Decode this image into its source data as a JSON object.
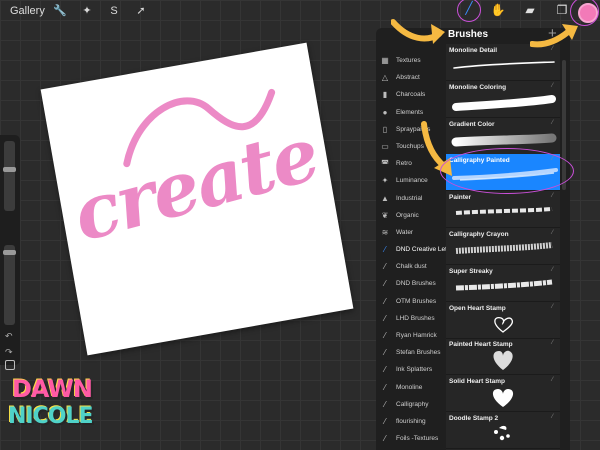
{
  "topbar": {
    "gallery_label": "Gallery",
    "left_tools": [
      {
        "icon": "wrench-icon",
        "glyph": "🔧"
      },
      {
        "icon": "magic-wand-icon",
        "glyph": "✦"
      },
      {
        "icon": "selection-icon",
        "glyph": "S"
      },
      {
        "icon": "transform-arrow-icon",
        "glyph": "➚"
      }
    ],
    "right_tools": [
      {
        "icon": "brush-icon",
        "glyph": "╱",
        "active": true
      },
      {
        "icon": "smudge-icon",
        "glyph": "✋"
      },
      {
        "icon": "eraser-icon",
        "glyph": "▰"
      },
      {
        "icon": "layers-icon",
        "glyph": "❐"
      }
    ],
    "active_color": "#f27ab8"
  },
  "canvas": {
    "lettering": "create",
    "ink_color": "#ec8ac6"
  },
  "logo": {
    "line1": "DAWN",
    "line2": "NICOLE"
  },
  "library": {
    "title": "Brushes",
    "add_label": "+",
    "brush_sets": [
      {
        "label": "Textures",
        "icon": "textures-icon",
        "glyph": "▦"
      },
      {
        "label": "Abstract",
        "icon": "triangle-icon",
        "glyph": "△"
      },
      {
        "label": "Charcoals",
        "icon": "charcoal-icon",
        "glyph": "▮"
      },
      {
        "label": "Elements",
        "icon": "elements-icon",
        "glyph": "●"
      },
      {
        "label": "Spraypaints",
        "icon": "spraycan-icon",
        "glyph": "▯"
      },
      {
        "label": "Touchups",
        "icon": "touchup-icon",
        "glyph": "▭"
      },
      {
        "label": "Retro",
        "icon": "retro-icon",
        "glyph": "◚"
      },
      {
        "label": "Luminance",
        "icon": "sparkle-icon",
        "glyph": "✦"
      },
      {
        "label": "Industrial",
        "icon": "anvil-icon",
        "glyph": "▲"
      },
      {
        "label": "Organic",
        "icon": "leaf-icon",
        "glyph": "❦"
      },
      {
        "label": "Water",
        "icon": "waves-icon",
        "glyph": "≋"
      },
      {
        "label": "DND Creative Letteri...",
        "icon": "brush-stroke-icon",
        "glyph": "⁄",
        "active": true
      },
      {
        "label": "Chalk dust",
        "icon": "brush-stroke-icon",
        "glyph": "⁄"
      },
      {
        "label": "DND Brushes",
        "icon": "brush-stroke-icon",
        "glyph": "⁄"
      },
      {
        "label": "OTM Brushes",
        "icon": "brush-stroke-icon",
        "glyph": "⁄"
      },
      {
        "label": "LHD Brushes",
        "icon": "brush-stroke-icon",
        "glyph": "⁄"
      },
      {
        "label": "Ryan Hamrick",
        "icon": "brush-stroke-icon",
        "glyph": "⁄"
      },
      {
        "label": "Stefan Brushes",
        "icon": "brush-stroke-icon",
        "glyph": "⁄"
      },
      {
        "label": "Ink Splatters",
        "icon": "brush-stroke-icon",
        "glyph": "⁄"
      },
      {
        "label": "Monoline",
        "icon": "brush-stroke-icon",
        "glyph": "⁄"
      },
      {
        "label": "Calligraphy",
        "icon": "brush-stroke-icon",
        "glyph": "⁄"
      },
      {
        "label": "flourishing",
        "icon": "brush-stroke-icon",
        "glyph": "⁄"
      },
      {
        "label": "Foils -Textures",
        "icon": "brush-stroke-icon",
        "glyph": "⁄"
      }
    ],
    "brushes": [
      {
        "name": "Monoline Detail",
        "stroke": "thin-line"
      },
      {
        "name": "Monoline Coloring",
        "stroke": "thick-line"
      },
      {
        "name": "Gradient Color",
        "stroke": "gradient"
      },
      {
        "name": "Calligraphy Painted",
        "stroke": "painted",
        "selected": true
      },
      {
        "name": "Painter",
        "stroke": "painter"
      },
      {
        "name": "Calligraphy Crayon",
        "stroke": "crayon"
      },
      {
        "name": "Super Streaky",
        "stroke": "streaky"
      },
      {
        "name": "Open Heart Stamp",
        "stroke": "open-heart"
      },
      {
        "name": "Painted Heart Stamp",
        "stroke": "painted-heart"
      },
      {
        "name": "Solid Heart Stamp",
        "stroke": "solid-heart"
      },
      {
        "name": "Doodle Stamp 2",
        "stroke": "doodle"
      }
    ],
    "selection_color": "#1a86ff"
  },
  "annotations": {
    "arrow_color": "#f5b942",
    "ring_color": "#c94fd8"
  }
}
